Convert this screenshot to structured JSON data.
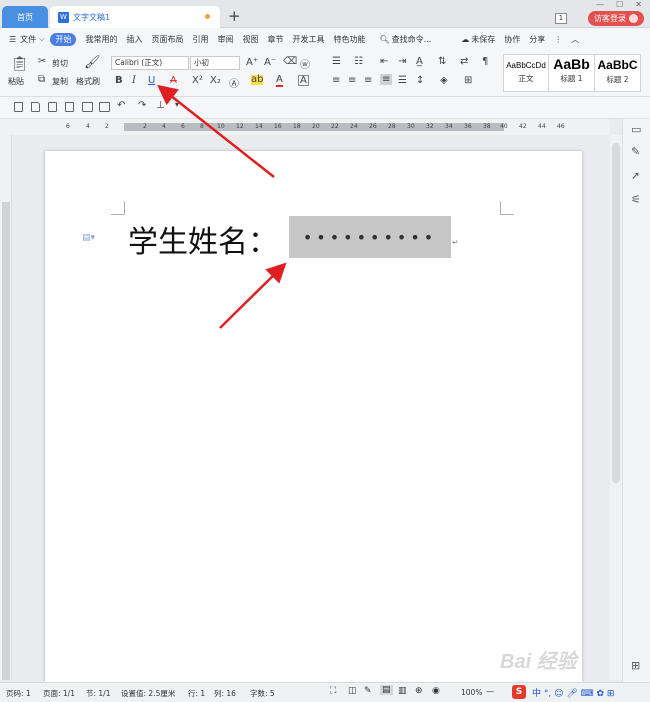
{
  "tabs": {
    "home": "首页",
    "doc": "文字文稿1",
    "new": "+"
  },
  "titlebar": {
    "badge": "1",
    "visitor_login": "访客登录"
  },
  "menu": {
    "file": "文件",
    "items": [
      "开始",
      "我常用的",
      "插入",
      "页面布局",
      "引用",
      "审阅",
      "视图",
      "章节",
      "开发工具",
      "特色功能"
    ],
    "search": "查找命令...",
    "unsaved": "未保存",
    "collab": "协作",
    "share": "分享"
  },
  "ribbon": {
    "paste": "粘贴",
    "cut": "剪切",
    "copy": "复制",
    "format_painter": "格式刷",
    "font_name": "Calibri (正文)",
    "font_size": "小初",
    "styles": [
      {
        "preview": "AaBbCcDd",
        "label": "正文"
      },
      {
        "preview": "AaBb",
        "label": "标题 1"
      },
      {
        "preview": "AaBbC",
        "label": "标题 2"
      }
    ]
  },
  "ruler": {
    "ticks": [
      "6",
      "4",
      "2",
      "",
      "2",
      "4",
      "6",
      "8",
      "10",
      "12",
      "14",
      "16",
      "18",
      "20",
      "22",
      "24",
      "26",
      "28",
      "30",
      "32",
      "34",
      "36",
      "38",
      "40",
      "42",
      "44",
      "46"
    ]
  },
  "document": {
    "label": "学生姓名：",
    "fill_field": "••••••••••"
  },
  "status": {
    "page_num": "页码: 1",
    "page": "页面: 1/1",
    "section": "节: 1/1",
    "setting": "设置值: 2.5厘米",
    "row": "行: 1",
    "col": "列: 16",
    "chars": "字数: 5",
    "zoom": "100%"
  },
  "watermark": "Bai 经验",
  "colors": {
    "accent": "#4a7ee6",
    "arrow": "#e02020",
    "visitor": "#e2514f"
  }
}
